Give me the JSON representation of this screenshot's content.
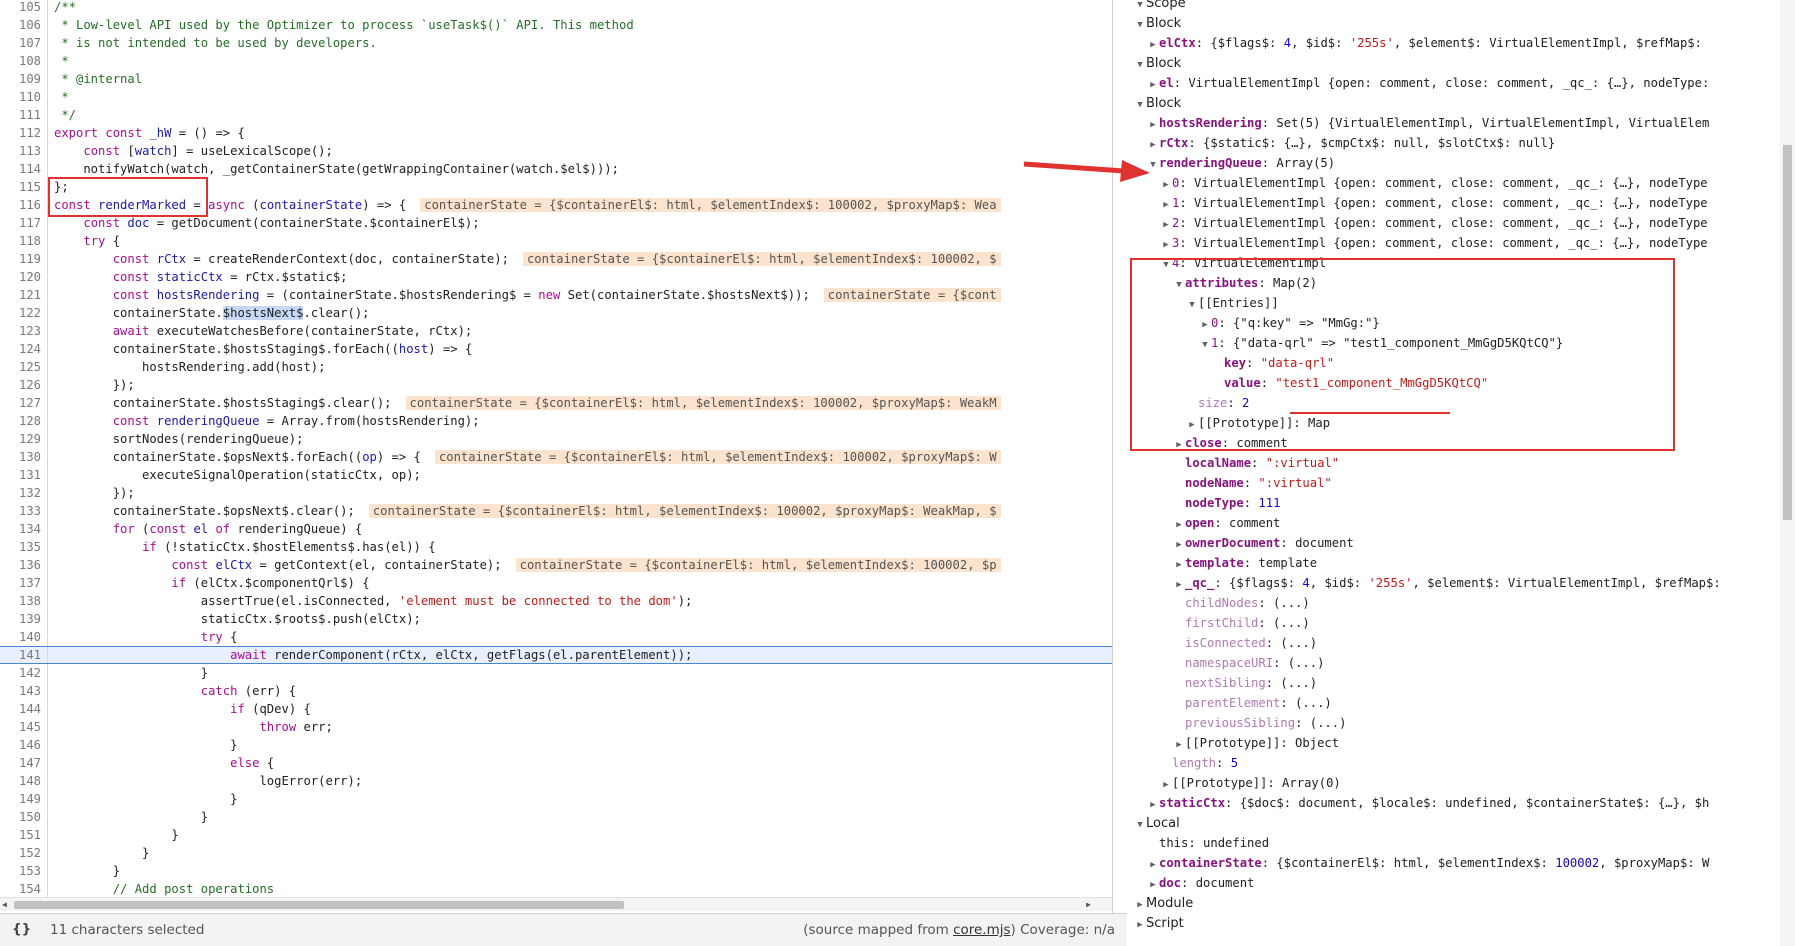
{
  "editor": {
    "lines": [
      {
        "n": "105",
        "h": "<span class=\"cm\">/**</span>"
      },
      {
        "n": "106",
        "h": "<span class=\"cm\"> * Low-level API used by the Optimizer to process `useTask$()` API. This method</span>"
      },
      {
        "n": "107",
        "h": "<span class=\"cm\"> * is not intended to be used by developers.</span>"
      },
      {
        "n": "108",
        "h": "<span class=\"cm\"> *</span>"
      },
      {
        "n": "109",
        "h": "<span class=\"cm\"> * @internal</span>"
      },
      {
        "n": "110",
        "h": "<span class=\"cm\"> *</span>"
      },
      {
        "n": "111",
        "h": "<span class=\"cm\"> */</span>"
      },
      {
        "n": "112",
        "h": "<span class=\"kw\">export const</span> <span class=\"def\">_hW</span> = () => {"
      },
      {
        "n": "113",
        "h": "    <span class=\"kw\">const</span> [<span class=\"def\">watch</span>] = useLexicalScope();"
      },
      {
        "n": "114",
        "h": "    notifyWatch(watch, _getContainerState(getWrappingContainer(watch.$el$)));"
      },
      {
        "n": "115",
        "h": "};"
      },
      {
        "n": "116",
        "h": "<span class=\"kw\">const</span> <span class=\"def\">renderMarked</span> = <span class=\"kw\">async</span> (<span class=\"def\">containerState</span>) => {<span class=\"inl\">containerState = {$containerEl$: html, $elementIndex$: 100002, $proxyMap$: Wea</span>"
      },
      {
        "n": "117",
        "h": "    <span class=\"kw\">const</span> <span class=\"def\">doc</span> = getDocument(containerState.$containerEl$);"
      },
      {
        "n": "118",
        "h": "    <span class=\"kw\">try</span> {"
      },
      {
        "n": "119",
        "h": "        <span class=\"kw\">const</span> <span class=\"def\">rCtx</span> = createRenderContext(doc, containerState);<span class=\"inl\">containerState = {$containerEl$: html, $elementIndex$: 100002, $</span>"
      },
      {
        "n": "120",
        "h": "        <span class=\"kw\">const</span> <span class=\"def\">staticCtx</span> = rCtx.$static$;"
      },
      {
        "n": "121",
        "h": "        <span class=\"kw\">const</span> <span class=\"def\">hostsRendering</span> = (containerState.$hostsRendering$ = <span class=\"kw\">new</span> Set(containerState.$hostsNext$));<span class=\"inl\">containerState = {$cont</span>"
      },
      {
        "n": "122",
        "h": "        containerState.<span class=\"sel\">$hostsNext$</span>.clear();"
      },
      {
        "n": "123",
        "h": "        <span class=\"kw\">await</span> executeWatchesBefore(containerState, rCtx);"
      },
      {
        "n": "124",
        "h": "        containerState.$hostsStaging$.forEach((<span class=\"def\">host</span>) => {"
      },
      {
        "n": "125",
        "h": "            hostsRendering.add(host);"
      },
      {
        "n": "126",
        "h": "        });"
      },
      {
        "n": "127",
        "h": "        containerState.$hostsStaging$.clear();<span class=\"inl\">containerState = {$containerEl$: html, $elementIndex$: 100002, $proxyMap$: WeakM</span>"
      },
      {
        "n": "128",
        "h": "        <span class=\"kw\">const</span> <span class=\"def\">renderingQueue</span> = Array.from(hostsRendering);"
      },
      {
        "n": "129",
        "h": "        sortNodes(renderingQueue);"
      },
      {
        "n": "130",
        "h": "        containerState.$opsNext$.forEach((<span class=\"def\">op</span>) => {<span class=\"inl\">containerState = {$containerEl$: html, $elementIndex$: 100002, $proxyMap$: W</span>"
      },
      {
        "n": "131",
        "h": "            executeSignalOperation(staticCtx, op);"
      },
      {
        "n": "132",
        "h": "        });"
      },
      {
        "n": "133",
        "h": "        containerState.$opsNext$.clear();<span class=\"inl\">containerState = {$containerEl$: html, $elementIndex$: 100002, $proxyMap$: WeakMap, $</span>"
      },
      {
        "n": "134",
        "h": "        <span class=\"kw\">for</span> (<span class=\"kw\">const</span> <span class=\"def\">el</span> <span class=\"kw\">of</span> renderingQueue) {"
      },
      {
        "n": "135",
        "h": "            <span class=\"kw\">if</span> (!staticCtx.$hostElements$.has(el)) {"
      },
      {
        "n": "136",
        "h": "                <span class=\"kw\">const</span> <span class=\"def\">elCtx</span> = getContext(el, containerState);<span class=\"inl\">containerState = {$containerEl$: html, $elementIndex$: 100002, $p</span>"
      },
      {
        "n": "137",
        "h": "                <span class=\"kw\">if</span> (elCtx.$componentQrl$) {"
      },
      {
        "n": "138",
        "h": "                    assertTrue(el.isConnected, <span class=\"str\">'element must be connected to the dom'</span>);"
      },
      {
        "n": "139",
        "h": "                    staticCtx.$roots$.push(elCtx);"
      },
      {
        "n": "140",
        "h": "                    <span class=\"kw\">try</span> {"
      },
      {
        "n": "141",
        "h": "                        <span class=\"kw\">await</span> renderComponent(rCtx, elCtx, getFlags(el.parentElement));",
        "exec": true
      },
      {
        "n": "142",
        "h": "                    }"
      },
      {
        "n": "143",
        "h": "                    <span class=\"kw\">catch</span> (err) {"
      },
      {
        "n": "144",
        "h": "                        <span class=\"kw\">if</span> (qDev) {"
      },
      {
        "n": "145",
        "h": "                            <span class=\"kw\">throw</span> err;"
      },
      {
        "n": "146",
        "h": "                        }"
      },
      {
        "n": "147",
        "h": "                        <span class=\"kw\">else</span> {"
      },
      {
        "n": "148",
        "h": "                            logError(err);"
      },
      {
        "n": "149",
        "h": "                        }"
      },
      {
        "n": "150",
        "h": "                    }"
      },
      {
        "n": "151",
        "h": "                }"
      },
      {
        "n": "152",
        "h": "            }"
      },
      {
        "n": "153",
        "h": "        }"
      },
      {
        "n": "154",
        "h": "        <span class=\"cm\">// Add post operations</span>"
      }
    ]
  },
  "status": {
    "braces": "{}",
    "selection": "11 characters selected",
    "source_prefix": "(source mapped from ",
    "source_link": "core.mjs",
    "source_suffix": ") Coverage: n/a"
  },
  "scope": {
    "rows": [
      {
        "i": 0,
        "t": "▼",
        "h": "<span class=\"hdr\">Scope</span>"
      },
      {
        "i": 0,
        "t": "▼",
        "h": "<span class=\"hdr\">Block</span>"
      },
      {
        "i": 1,
        "t": "▶",
        "h": "<span class=\"rname\">elCtx</span>: {$flags$: <span class=\"nval\">4</span>, $id$: <span class=\"sval\">'255s'</span>, $element$: VirtualElementImpl, $refMap$:"
      },
      {
        "i": 0,
        "t": "▼",
        "h": "<span class=\"hdr\">Block</span>"
      },
      {
        "i": 1,
        "t": "▶",
        "h": "<span class=\"rname\">el</span>: VirtualElementImpl {open: comment, close: comment, _qc_: {…}, nodeType:"
      },
      {
        "i": 0,
        "t": "▼",
        "h": "<span class=\"hdr\">Block</span>"
      },
      {
        "i": 1,
        "t": "▶",
        "h": "<span class=\"rname\">hostsRendering</span>: Set(5) {VirtualElementImpl, VirtualElementImpl, VirtualElem"
      },
      {
        "i": 1,
        "t": "▶",
        "h": "<span class=\"rname\">rCtx</span>: {$static$: {…}, $cmpCtx$: null, $slotCtx$: null}"
      },
      {
        "i": 1,
        "t": "▼",
        "h": "<span class=\"rname\">renderingQueue</span>: Array(5)"
      },
      {
        "i": 2,
        "t": "▶",
        "h": "<span class=\"rname nb\">0</span>: VirtualElementImpl {open: comment, close: comment, _qc_: {…}, nodeType"
      },
      {
        "i": 2,
        "t": "▶",
        "h": "<span class=\"rname nb\">1</span>: VirtualElementImpl {open: comment, close: comment, _qc_: {…}, nodeType"
      },
      {
        "i": 2,
        "t": "▶",
        "h": "<span class=\"rname nb\">2</span>: VirtualElementImpl {open: comment, close: comment, _qc_: {…}, nodeType"
      },
      {
        "i": 2,
        "t": "▶",
        "h": "<span class=\"rname nb\">3</span>: VirtualElementImpl {open: comment, close: comment, _qc_: {…}, nodeType"
      },
      {
        "i": 2,
        "t": "▼",
        "h": "<span class=\"rname nb\">4</span>: VirtualElementImpl"
      },
      {
        "i": 3,
        "t": "▼",
        "h": "<span class=\"rname\">attributes</span>: Map(2)"
      },
      {
        "i": 4,
        "t": "▼",
        "h": "[[Entries]]"
      },
      {
        "i": 5,
        "t": "▶",
        "h": "<span class=\"rname nb\">0</span>: {\"q:key\" => \"MmGg:\"}"
      },
      {
        "i": 5,
        "t": "▼",
        "h": "<span class=\"rname nb\">1</span>: {\"data-qrl\" => \"test1_component_MmGgD5KQtCQ\"}"
      },
      {
        "i": 6,
        "t": "",
        "h": "<span class=\"rname\">key</span>: <span class=\"sval\">\"data-qrl\"</span>"
      },
      {
        "i": 6,
        "t": "",
        "h": "<span class=\"rname\">value</span>: <span class=\"sval\">\"test1_component_MmGgD5KQtCQ\"</span>"
      },
      {
        "i": 4,
        "t": "",
        "h": "<span class=\"rname sz\">size</span>: <span class=\"nval\">2</span>"
      },
      {
        "i": 4,
        "t": "▶",
        "h": "[[Prototype]]: Map"
      },
      {
        "i": 3,
        "t": "▶",
        "h": "<span class=\"rname\">close</span>: comment"
      },
      {
        "i": 3,
        "t": "",
        "h": "<span class=\"rname\">localName</span>: <span class=\"sval\">\":virtual\"</span>"
      },
      {
        "i": 3,
        "t": "",
        "h": "<span class=\"rname\">nodeName</span>: <span class=\"sval\">\":virtual\"</span>"
      },
      {
        "i": 3,
        "t": "",
        "h": "<span class=\"rname\">nodeType</span>: <span class=\"nval\">111</span>"
      },
      {
        "i": 3,
        "t": "▶",
        "h": "<span class=\"rname\">open</span>: comment"
      },
      {
        "i": 3,
        "t": "▶",
        "h": "<span class=\"rname\">ownerDocument</span>: document"
      },
      {
        "i": 3,
        "t": "▶",
        "h": "<span class=\"rname\">template</span>: template"
      },
      {
        "i": 3,
        "t": "▶",
        "h": "<span class=\"rname\">_qc_</span>: {$flags$: <span class=\"nval\">4</span>, $id$: <span class=\"sval\">'255s'</span>, $element$: VirtualElementImpl, $refMap$:"
      },
      {
        "i": 3,
        "t": "",
        "h": "<span class=\"rname acc\">childNodes</span>: (...)"
      },
      {
        "i": 3,
        "t": "",
        "h": "<span class=\"rname acc\">firstChild</span>: (...)"
      },
      {
        "i": 3,
        "t": "",
        "h": "<span class=\"rname acc\">isConnected</span>: (...)"
      },
      {
        "i": 3,
        "t": "",
        "h": "<span class=\"rname acc\">namespaceURI</span>: (...)"
      },
      {
        "i": 3,
        "t": "",
        "h": "<span class=\"rname acc\">nextSibling</span>: (...)"
      },
      {
        "i": 3,
        "t": "",
        "h": "<span class=\"rname acc\">parentElement</span>: (...)"
      },
      {
        "i": 3,
        "t": "",
        "h": "<span class=\"rname acc\">previousSibling</span>: (...)"
      },
      {
        "i": 3,
        "t": "▶",
        "h": "[[Prototype]]: Object"
      },
      {
        "i": 2,
        "t": "",
        "h": "<span class=\"rname sz\">length</span>: <span class=\"nval\">5</span>"
      },
      {
        "i": 2,
        "t": "▶",
        "h": "[[Prototype]]: Array(0)"
      },
      {
        "i": 1,
        "t": "▶",
        "h": "<span class=\"rname\">staticCtx</span>: {$doc$: document, $locale$: undefined, $containerState$: {…}, $h"
      },
      {
        "i": 0,
        "t": "▼",
        "h": "<span class=\"hdr\">Local</span>"
      },
      {
        "i": 1,
        "t": "",
        "h": "this: undefined"
      },
      {
        "i": 1,
        "t": "▶",
        "h": "<span class=\"rname\">containerState</span>: {$containerEl$: html, $elementIndex$: <span class=\"nval\">100002</span>, $proxyMap$: W"
      },
      {
        "i": 1,
        "t": "▶",
        "h": "<span class=\"rname\">doc</span>: document"
      },
      {
        "i": 0,
        "t": "▶",
        "h": "<span class=\"hdr\">Module</span>"
      },
      {
        "i": 0,
        "t": "▶",
        "h": "<span class=\"hdr\">Script</span>"
      }
    ]
  }
}
